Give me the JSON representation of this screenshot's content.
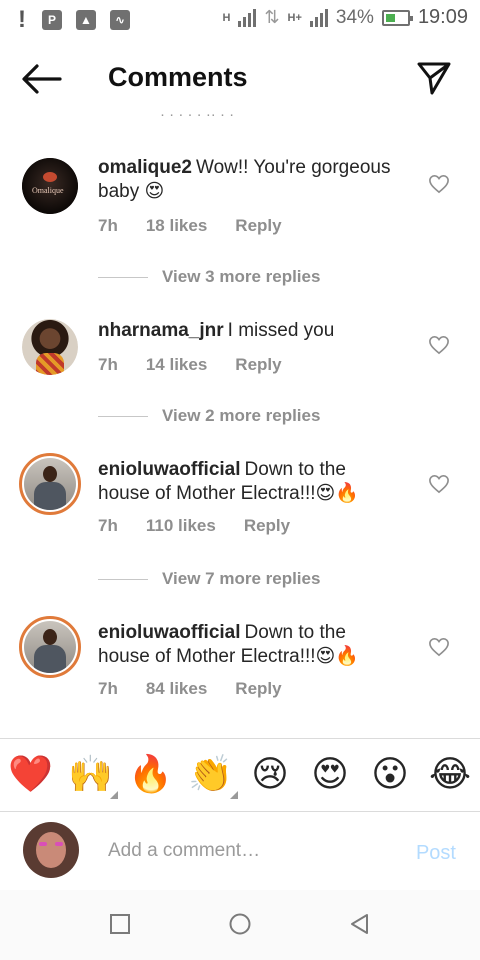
{
  "status_bar": {
    "battery": "34%",
    "time": "19:09",
    "network_1": "H",
    "network_2": "H+"
  },
  "header": {
    "title": "Comments"
  },
  "comments": [
    {
      "username": "omalique2",
      "text": "Wow!! You're gorgeous baby 😍",
      "avatar_text": "Omalique",
      "time": "7h",
      "likes": "18 likes",
      "reply": "Reply",
      "view_replies": "View 3 more replies"
    },
    {
      "username": "nharnama_jnr",
      "text": "I missed you",
      "time": "7h",
      "likes": "14 likes",
      "reply": "Reply",
      "view_replies": "View 2 more replies"
    },
    {
      "username": "enioluwaofficial",
      "text": "Down to the house of Mother Electra!!!😍🔥",
      "time": "7h",
      "likes": "110 likes",
      "reply": "Reply",
      "view_replies": "View 7 more replies"
    },
    {
      "username": "enioluwaofficial",
      "text": "Down to the house of Mother Electra!!!😍🔥",
      "time": "7h",
      "likes": "84 likes",
      "reply": "Reply"
    }
  ],
  "emoji_bar": [
    "❤️",
    "🙌",
    "🔥",
    "👏",
    "😢",
    "😍",
    "😮",
    "😂"
  ],
  "composer": {
    "placeholder": "Add a comment…",
    "post_label": "Post"
  },
  "colors": {
    "text": "#262626",
    "meta": "#8e8e8e",
    "post_disabled": "#b3dbff",
    "story_ring": "#e1306c"
  }
}
